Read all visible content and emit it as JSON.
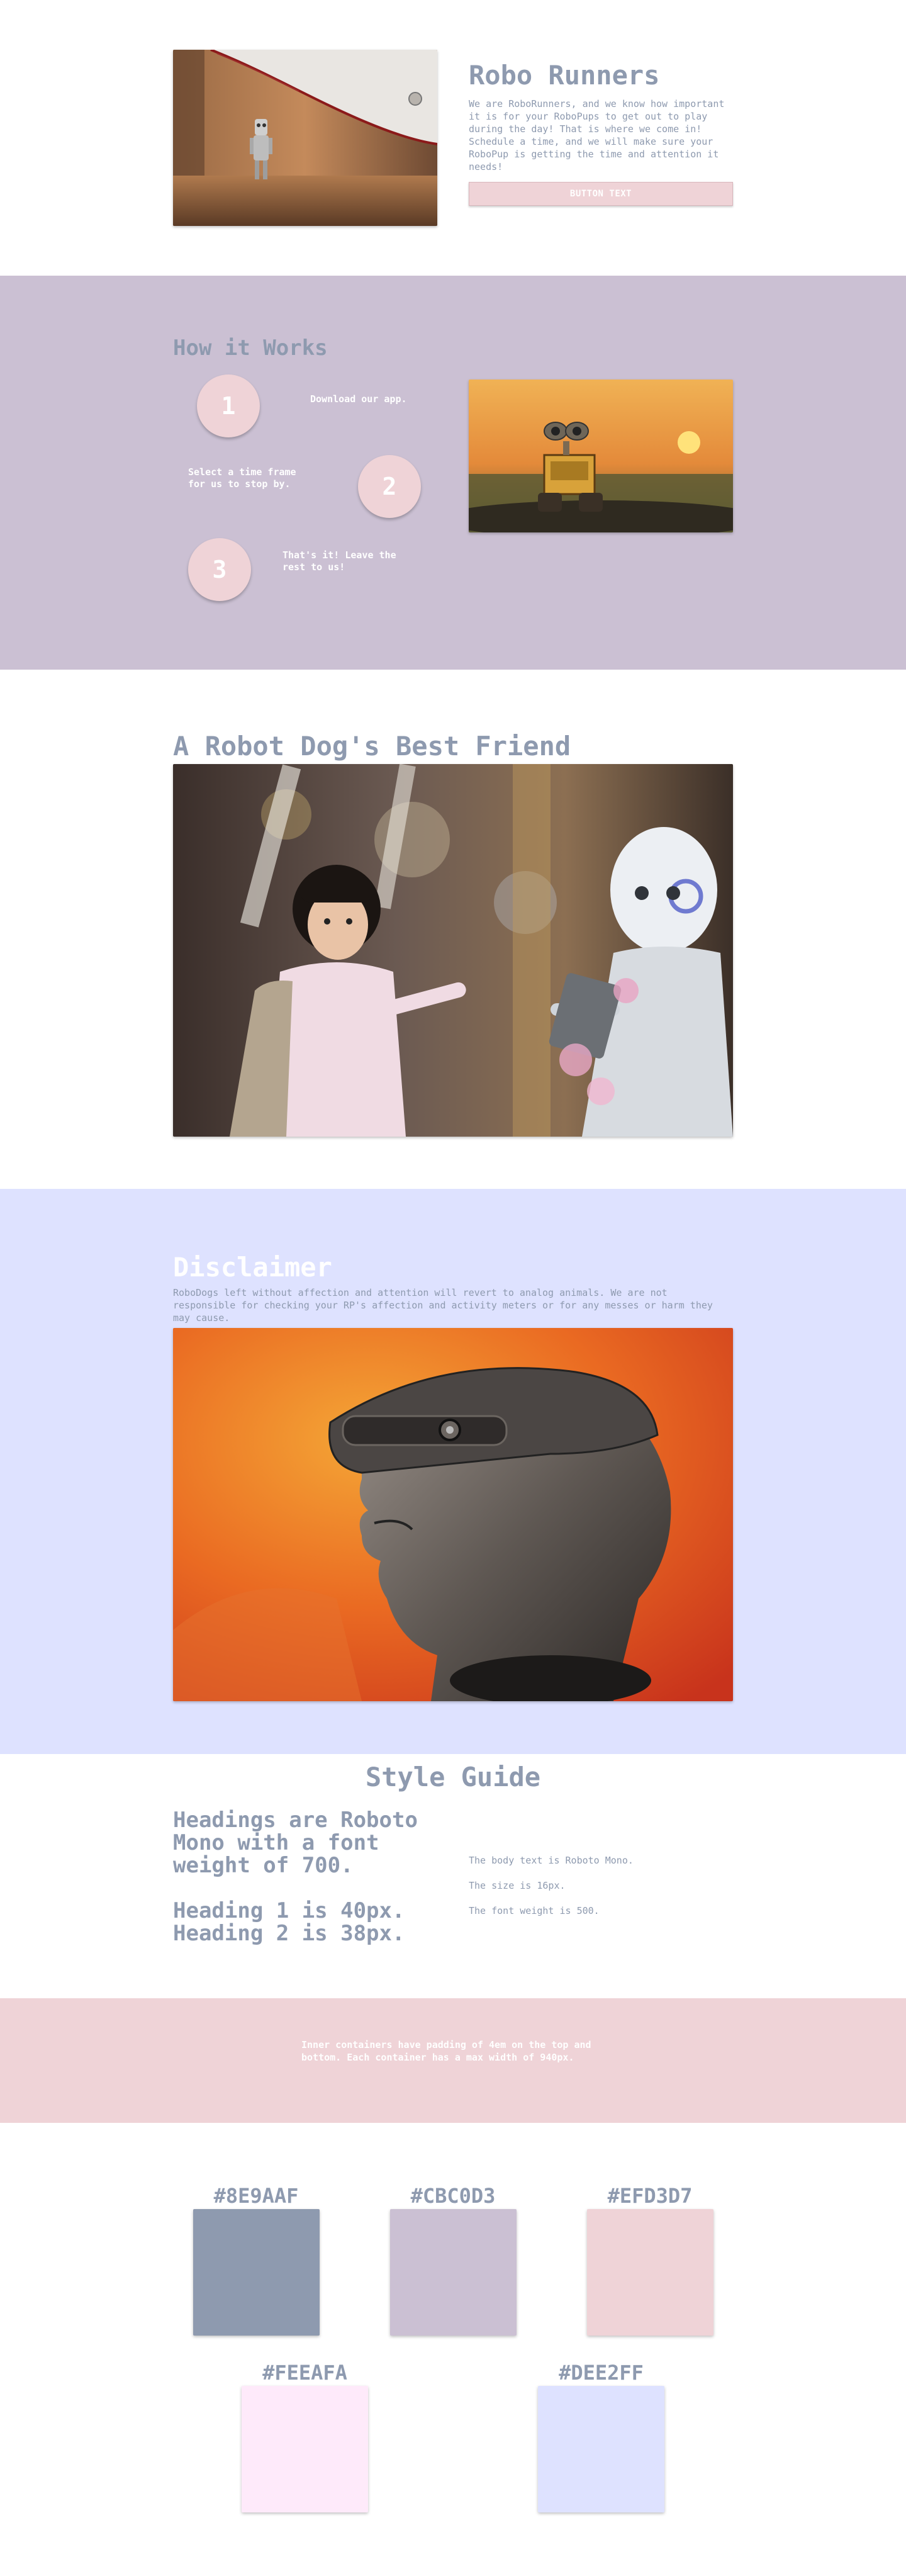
{
  "colors": {
    "slate": "#8E9AAF",
    "lilac": "#CBC0D3",
    "pink": "#EFD3D7",
    "blush": "#FEEAFA",
    "periwinkle": "#DEE2FF"
  },
  "hero": {
    "title": "Robo Runners",
    "body": "We are RoboRunners, and we know how important it is for your RoboPups to get out to play during the day! That is where we come in! Schedule a time, and we will make sure your RoboPup is getting the time and attention it needs!",
    "button_label": "BUTTON TEXT",
    "image_icon": "robot-walking-under-sneaker-photo"
  },
  "how": {
    "title": "How it Works",
    "steps": [
      {
        "number": "1",
        "text": "Download our app."
      },
      {
        "number": "2",
        "text": "Select a time frame for us to stop by."
      },
      {
        "number": "3",
        "text": "That's it! Leave the rest to us!"
      }
    ],
    "image_icon": "wall-e-robot-sunset-photo"
  },
  "friend": {
    "title": "A Robot Dog's Best Friend",
    "image_icon": "girl-shaking-hands-with-robot-photo"
  },
  "disclaimer": {
    "title": "Disclaimer",
    "body": "RoboDogs left without affection and attention will revert to analog animals. We are not responsible for checking your RP's affection and activity meters or for any messes or harm they may cause.",
    "image_icon": "mannequin-vr-headset-photo"
  },
  "style_guide": {
    "title": "Style Guide",
    "heading_note_1": "Headings are Roboto Mono with a font weight of 700.",
    "heading_note_2": "Heading 1 is 40px. Heading 2 is 38px.",
    "body_notes": [
      "The body text is Roboto Mono.",
      "The size is 16px.",
      "The font weight is 500."
    ],
    "inner_note": "Inner containers have padding of 4em on the top and bottom. Each container has a max width of 940px."
  },
  "swatches": [
    {
      "label": "#8E9AAF",
      "color": "#8E9AAF"
    },
    {
      "label": "#CBC0D3",
      "color": "#CBC0D3"
    },
    {
      "label": "#EFD3D7",
      "color": "#EFD3D7"
    },
    {
      "label": "#FEEAFA",
      "color": "#FEEAFA"
    },
    {
      "label": "#DEE2FF",
      "color": "#DEE2FF"
    }
  ]
}
